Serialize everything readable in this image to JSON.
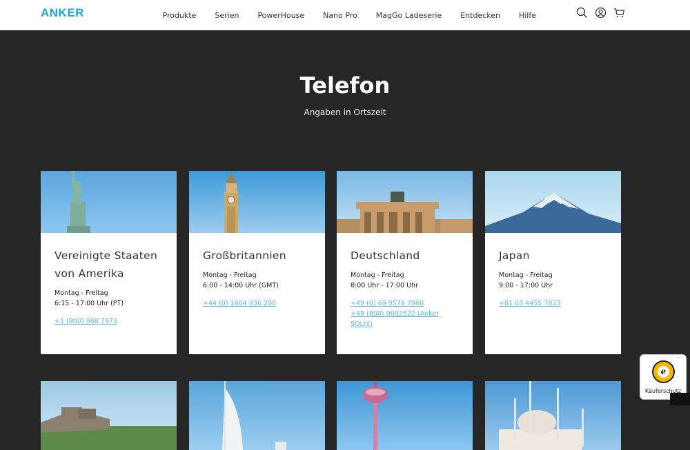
{
  "header": {
    "logo": "ANKER",
    "nav": [
      "Produkte",
      "Serien",
      "PowerHouse",
      "Nano Pro",
      "MagGo Ladeserie",
      "Entdecken",
      "Hilfe"
    ],
    "icons": [
      "search-icon",
      "account-icon",
      "cart-icon"
    ]
  },
  "hero": {
    "title": "Telefon",
    "subtitle": "Angaben in Ortszeit"
  },
  "cards": [
    {
      "country_line1": "Vereinigte Staaten",
      "country_line2": "von Amerika",
      "days": "Montag - Freitag",
      "time": "6:15 - 17:00 Uhr (PT)",
      "phone1": "+1 (800) 988 7973",
      "phone2": ""
    },
    {
      "country_line1": "Großbritannien",
      "country_line2": "",
      "days": "Montag - Freitag",
      "time": "6:00 - 14:00 Uhr (GMT)",
      "phone1": "+44 (0) 1604 936 200",
      "phone2": ""
    },
    {
      "country_line1": "Deutschland",
      "country_line2": "",
      "days": "Montag - Freitag",
      "time": "8:00 Uhr - 17:00 Uhr",
      "phone1": "+49 (0) 69 9579 7960",
      "phone2": "+49 (800) 0002522 (Anker SOLIX)"
    },
    {
      "country_line1": "Japan",
      "country_line2": "",
      "days": "Montag - Freitag",
      "time": "9:00 - 17:00 Uhr",
      "phone1": "+81 03 4455 7823",
      "phone2": ""
    }
  ],
  "badge": {
    "seal_letter": "e",
    "label": "Käuferschutz",
    "menu": "···"
  },
  "colors": {
    "accent": "#1fa3e4",
    "link": "#5ab4e5",
    "background": "#262626"
  }
}
